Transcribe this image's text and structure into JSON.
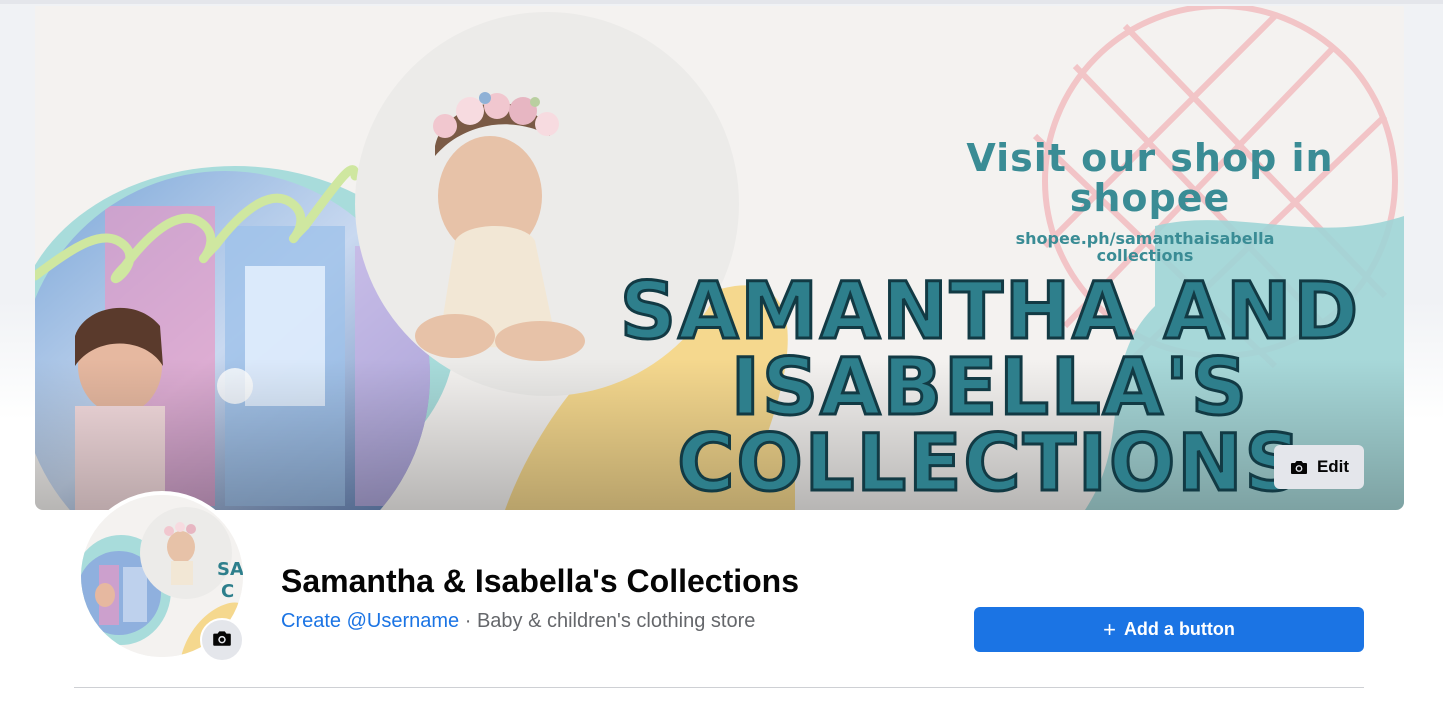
{
  "cover": {
    "visit_text": "Visit our shop in shopee",
    "url_text_1": "shopee.ph/samanthaisabella",
    "url_text_2": "collections",
    "title_line_1": "SAMANTHA AND",
    "title_line_2": "ISABELLA'S",
    "title_line_3": "COLLECTIONS",
    "edit_label": "Edit",
    "edit_icon": "camera-icon"
  },
  "profile": {
    "name": "Samantha & Isabella's Collections",
    "username_link": "Create @Username",
    "separator": " · ",
    "category": "Baby & children's clothing store",
    "avatar_camera_icon": "camera-icon"
  },
  "actions": {
    "add_button_label": "Add a button",
    "add_button_icon": "plus-icon"
  },
  "colors": {
    "accent_blue": "#1b74e4",
    "teal_title": "#2e7f8c",
    "button_grey": "#e4e6eb"
  }
}
